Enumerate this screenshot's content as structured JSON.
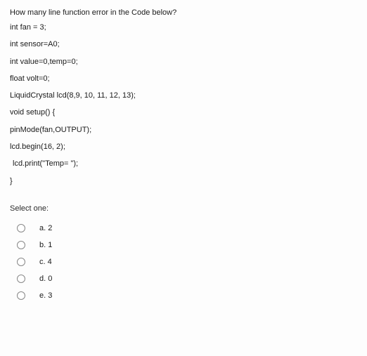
{
  "question": "How many line function error in the Code below?",
  "code": [
    "int fan = 3;",
    "int sensor=A0;",
    "int value=0,temp=0;",
    "float volt=0;",
    "LiquidCrystal lcd(8,9, 10, 11, 12, 13);",
    "void setup() {",
    "pinMode(fan,OUTPUT);",
    "lcd.begin(16, 2);",
    "lcd.print(\"Temp= \");",
    "}"
  ],
  "select_label": "Select one:",
  "options": [
    {
      "label": "a. 2"
    },
    {
      "label": "b. 1"
    },
    {
      "label": "c. 4"
    },
    {
      "label": "d. 0"
    },
    {
      "label": "e. 3"
    }
  ]
}
